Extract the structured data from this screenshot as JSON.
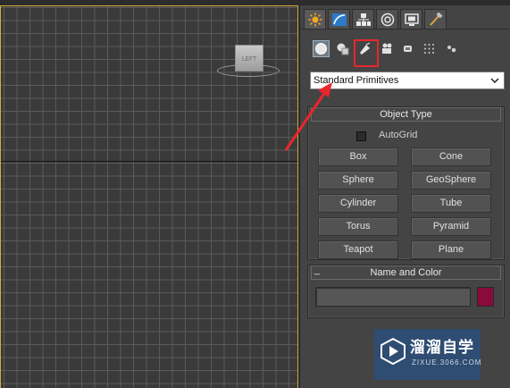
{
  "viewport": {
    "viewcube_label": "LEFT"
  },
  "command_panel": {
    "tabs": [
      {
        "name": "create",
        "icon": "sun-icon",
        "active": true
      },
      {
        "name": "modify",
        "icon": "arc-icon"
      },
      {
        "name": "hierarchy",
        "icon": "hierarchy-icon"
      },
      {
        "name": "motion",
        "icon": "motion-icon"
      },
      {
        "name": "display",
        "icon": "monitor-icon"
      },
      {
        "name": "utilities",
        "icon": "hammer-icon"
      }
    ],
    "categories": [
      {
        "name": "geometry",
        "icon": "sphere-icon",
        "active": true
      },
      {
        "name": "shapes",
        "icon": "shapes-icon"
      },
      {
        "name": "lights",
        "icon": "light-icon",
        "highlighted": true
      },
      {
        "name": "cameras",
        "icon": "camera-icon"
      },
      {
        "name": "helpers",
        "icon": "helper-icon"
      },
      {
        "name": "space-warps",
        "icon": "spacewarp-icon"
      },
      {
        "name": "systems",
        "icon": "systems-icon"
      }
    ],
    "dropdown_value": "Standard Primitives",
    "object_type": {
      "title": "Object Type",
      "autogrid_label": "AutoGrid",
      "buttons": [
        "Box",
        "Cone",
        "Sphere",
        "GeoSphere",
        "Cylinder",
        "Tube",
        "Torus",
        "Pyramid",
        "Teapot",
        "Plane"
      ]
    },
    "name_and_color": {
      "title": "Name and Color",
      "collapse_symbol": "_",
      "name_value": "",
      "color": "#8a0a3c"
    }
  },
  "watermark": {
    "title": "溜溜自学",
    "url": "ZIXUE.3066.COM"
  },
  "colors": {
    "highlight": "#e8272d",
    "viewport_border": "#d2a93c"
  }
}
